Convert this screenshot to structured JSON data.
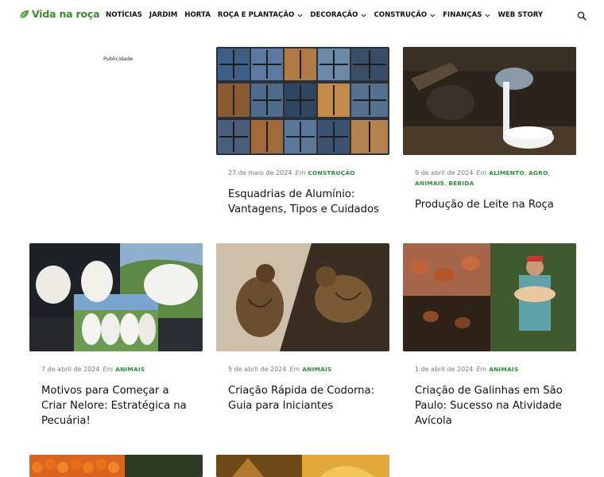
{
  "site": {
    "logo_text": "Vida na roça"
  },
  "nav": {
    "items": [
      {
        "label": "NOTÍCIAS"
      },
      {
        "label": "JARDIM"
      },
      {
        "label": "HORTA"
      },
      {
        "label": "ROÇA E PLANTAÇÃO"
      },
      {
        "label": "DECORAÇÃO"
      },
      {
        "label": "CONSTRUÇÃO"
      },
      {
        "label": "FINANÇAS"
      },
      {
        "label": "WEB STORY"
      }
    ]
  },
  "ad": {
    "label": "Publicidade"
  },
  "posts": [
    {
      "date": "27 de maio de 2024",
      "em": "Em",
      "categories": [
        "CONSTRUÇÃO"
      ],
      "title": "Esquadrias de Alumínio: Vantagens, Tipos e Cuidados"
    },
    {
      "date": "9 de abril de 2024",
      "em": "Em",
      "categories": [
        "ALIMENTO",
        "AGRO",
        "ANIMAIS",
        "BEBIDA"
      ],
      "title": "Produção de Leite na Roça"
    },
    {
      "date": "7 de abril de 2024",
      "em": "Em",
      "categories": [
        "ANIMAIS"
      ],
      "title": "Motivos para Começar a Criar Nelore: Estratégica na Pecuária!"
    },
    {
      "date": "5 de abril de 2024",
      "em": "Em",
      "categories": [
        "ANIMAIS"
      ],
      "title": "Criação Rápida de Codorna: Guia para Iniciantes"
    },
    {
      "date": "1 de abril de 2024",
      "em": "Em",
      "categories": [
        "ANIMAIS"
      ],
      "title": "Criação de Galinhas em São Paulo: Sucesso na Atividade Avícola"
    }
  ],
  "colors": {
    "brand_green": "#3b8a2f",
    "category_green": "#2f8a3c"
  }
}
